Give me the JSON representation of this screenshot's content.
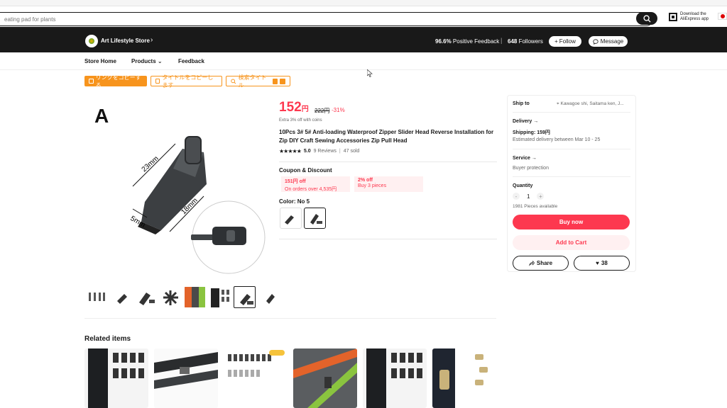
{
  "search": {
    "placeholder": "eating pad for plants"
  },
  "app_download": {
    "line1": "Download the",
    "line2": "AliExpress app"
  },
  "store": {
    "name": "Art Lifestyle Store",
    "positive_feedback_pct": "96.6%",
    "positive_feedback_label": "Positive Feedback",
    "separator": "|",
    "followers_count": "648",
    "followers_label": "Followers",
    "follow_label": "Follow",
    "message_label": "Message"
  },
  "subnav": {
    "store_home": "Store Home",
    "products": "Products",
    "feedback": "Feedback"
  },
  "extension": {
    "copy_link": "リンクをコピーする",
    "copy_title": "タイトルをコピーします",
    "search_title": "検索タイトル"
  },
  "product": {
    "image_letter": "A",
    "dim_23": "23mm",
    "dim_18": "18mm",
    "dim_5": "5mm",
    "price": "152",
    "currency": "円",
    "old_price": "222円",
    "discount": "-31%",
    "coins_note": "Extra 3% off with coins",
    "title": "10Pcs 3# 5# Anti-loading Waterproof Zipper Slider Head Reverse Installation for Zip DIY Craft Sewing Accessories Zip Pull Head",
    "rating": "5.0",
    "reviews": "9 Reviews",
    "rating_sep": "|",
    "sold": "47 sold",
    "coupon_heading": "Coupon & Discount",
    "coupons": [
      {
        "title": "151円 off",
        "cond": "On orders over 4,535円"
      },
      {
        "title": "2% off",
        "cond": "Buy 3 pieces"
      }
    ],
    "color_label": "Color: No 5"
  },
  "related": {
    "heading": "Related items"
  },
  "panel": {
    "ship_to_label": "Ship to",
    "ship_to_value": "Kawagoe shi, Saitama ken, J...",
    "delivery_label": "Delivery",
    "shipping": "Shipping: 159円",
    "estimate": "Estimated delivery between Mar 10 - 25",
    "service_label": "Service",
    "service_value": "Buyer protection",
    "quantity_label": "Quantity",
    "quantity_value": "1",
    "minus": "-",
    "plus": "+",
    "available": "1981 Pieces available",
    "buy_now": "Buy now",
    "add_to_cart": "Add to Cart",
    "share": "Share",
    "wishlist_count": "38"
  },
  "colors": {
    "accent": "#fd384f",
    "dark": "#191919",
    "extension": "#f7941d"
  }
}
